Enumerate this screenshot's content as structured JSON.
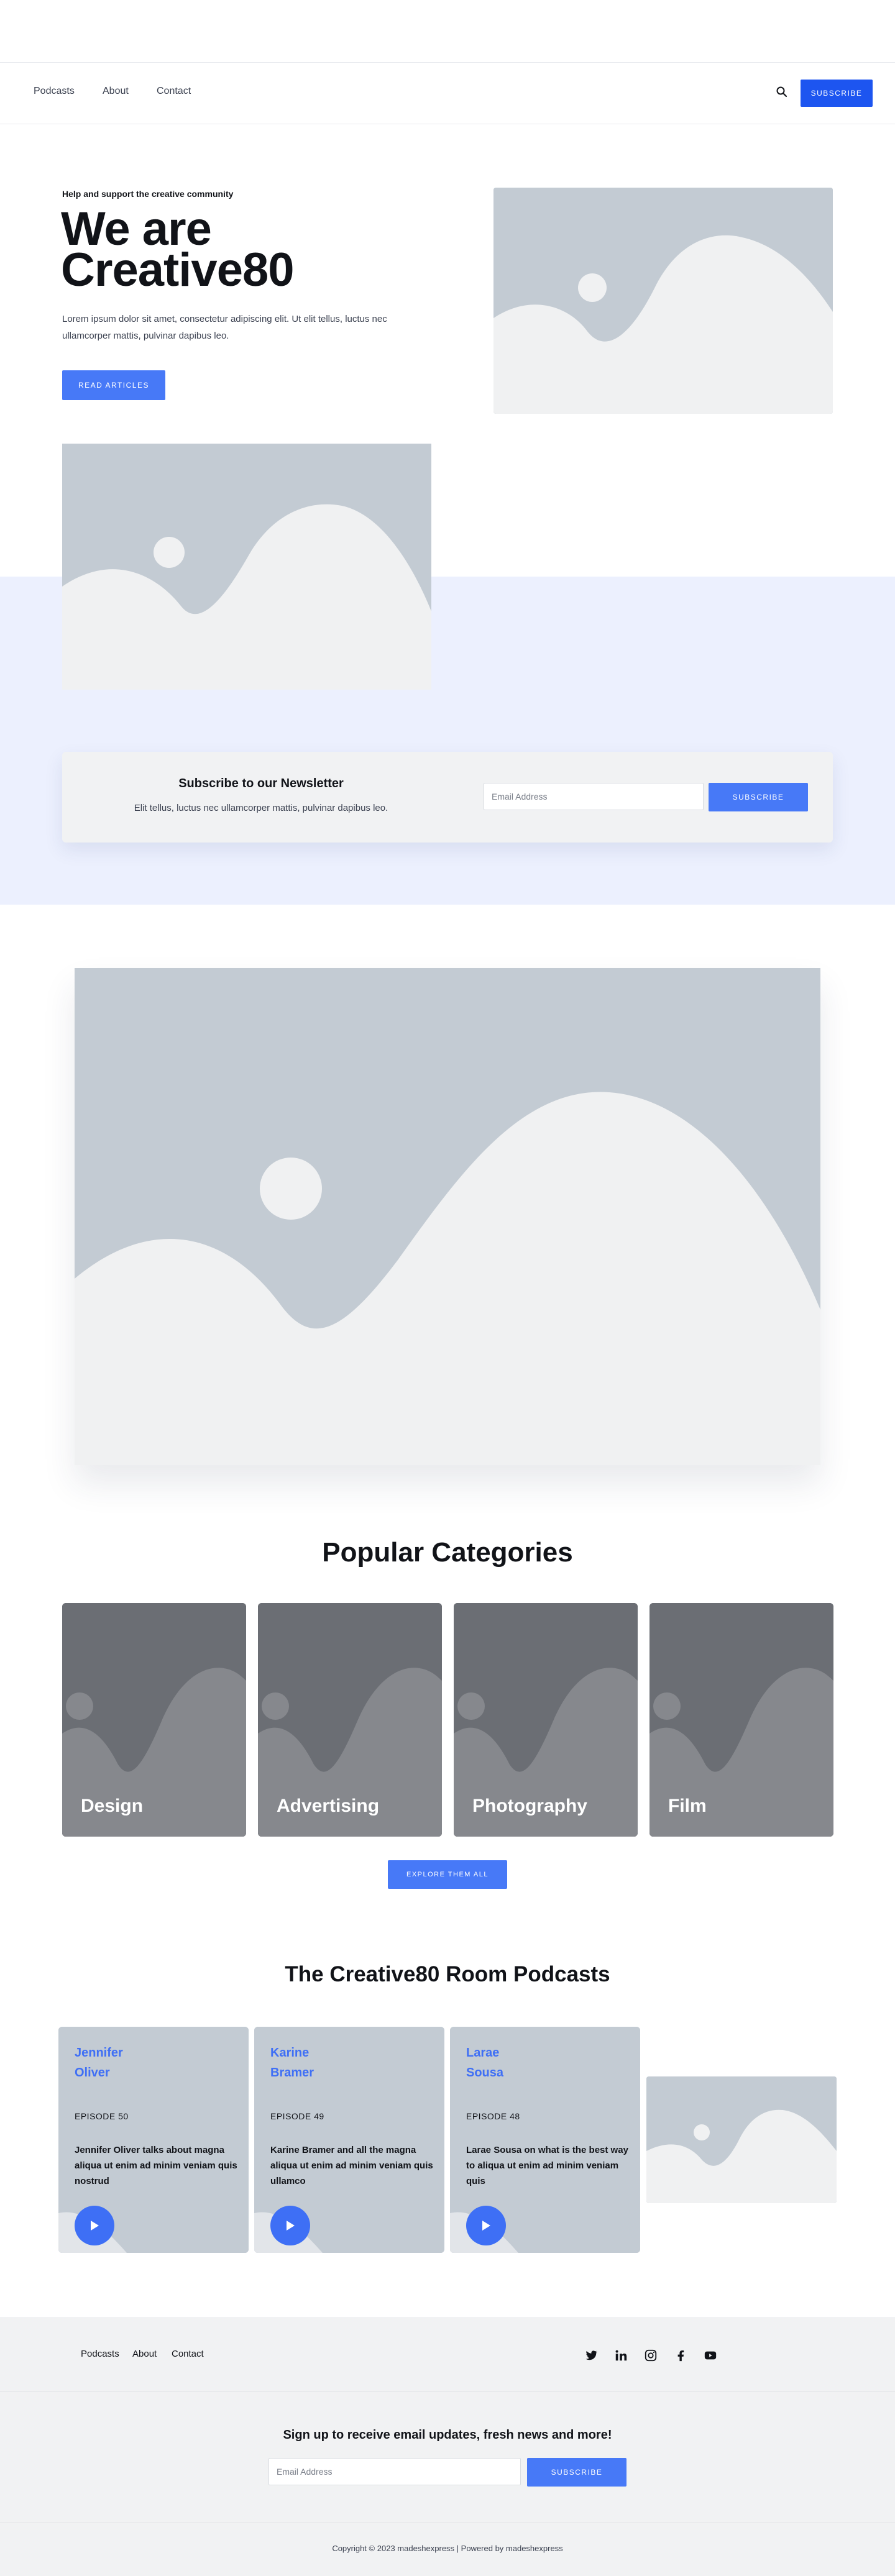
{
  "nav": {
    "links": [
      "Podcasts",
      "About",
      "Contact"
    ],
    "subscribe_label": "SUBSCRIBE"
  },
  "hero": {
    "eyebrow": "Help and support the creative community",
    "title_line1": "We are",
    "title_line2": "Creative80",
    "text": "Lorem ipsum dolor sit amet, consectetur adipiscing elit. Ut elit tellus, luctus nec ullamcorper mattis, pulvinar dapibus leo.",
    "cta_label": "READ ARTICLES"
  },
  "newsletter": {
    "title": "Subscribe to our Newsletter",
    "text": "Elit tellus, luctus nec ullamcorper mattis, pulvinar dapibus leo.",
    "email_placeholder": "Email Address",
    "button_label": "SUBSCRIBE"
  },
  "categories": {
    "heading": "Popular Categories",
    "items": [
      "Design",
      "Advertising",
      "Photography",
      "Film"
    ],
    "explore_label": "EXPLORE THEM ALL"
  },
  "podcasts": {
    "heading": "The Creative80 Room Podcasts",
    "items": [
      {
        "first": "Jennifer",
        "last": "Oliver",
        "episode": "EPISODE 50",
        "desc": "Jennifer Oliver talks about magna aliqua ut enim ad minim veniam quis nostrud"
      },
      {
        "first": "Karine",
        "last": "Bramer",
        "episode": "EPISODE 49",
        "desc": "Karine Bramer and all the magna aliqua ut enim ad minim veniam quis ullamco"
      },
      {
        "first": "Larae",
        "last": "Sousa",
        "episode": "EPISODE 48",
        "desc": "Larae Sousa on what is the best way to aliqua ut enim ad minim veniam quis"
      }
    ]
  },
  "footer": {
    "links": [
      "Podcasts",
      "About",
      "Contact"
    ],
    "social_icons": [
      "twitter-icon",
      "linkedin-icon",
      "instagram-icon",
      "facebook-icon",
      "youtube-icon"
    ],
    "signup_title": "Sign up to receive email updates, fresh news and more!",
    "email_placeholder": "Email Address",
    "button_label": "SUBSCRIBE",
    "copyright": "Copyright © 2023 madeshexpress | Powered by madeshexpress"
  },
  "colors": {
    "accent": "#1d55f0",
    "button_blue": "#4779f7",
    "band_bg": "#ecf0fe",
    "placeholder_gray": "#c3cbd3"
  }
}
